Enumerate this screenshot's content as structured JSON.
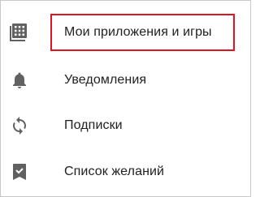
{
  "menu": {
    "items": [
      {
        "label": "Мои приложения и игры",
        "icon": "apps-grid-icon",
        "highlighted": true
      },
      {
        "label": "Уведомления",
        "icon": "bell-icon",
        "highlighted": false
      },
      {
        "label": "Подписки",
        "icon": "refresh-icon",
        "highlighted": false
      },
      {
        "label": "Список желаний",
        "icon": "bookmark-check-icon",
        "highlighted": false
      }
    ]
  },
  "colors": {
    "icon": "#616161",
    "text": "#212121",
    "highlight_border": "#e0141e",
    "frame_border": "#c9c9c9"
  }
}
